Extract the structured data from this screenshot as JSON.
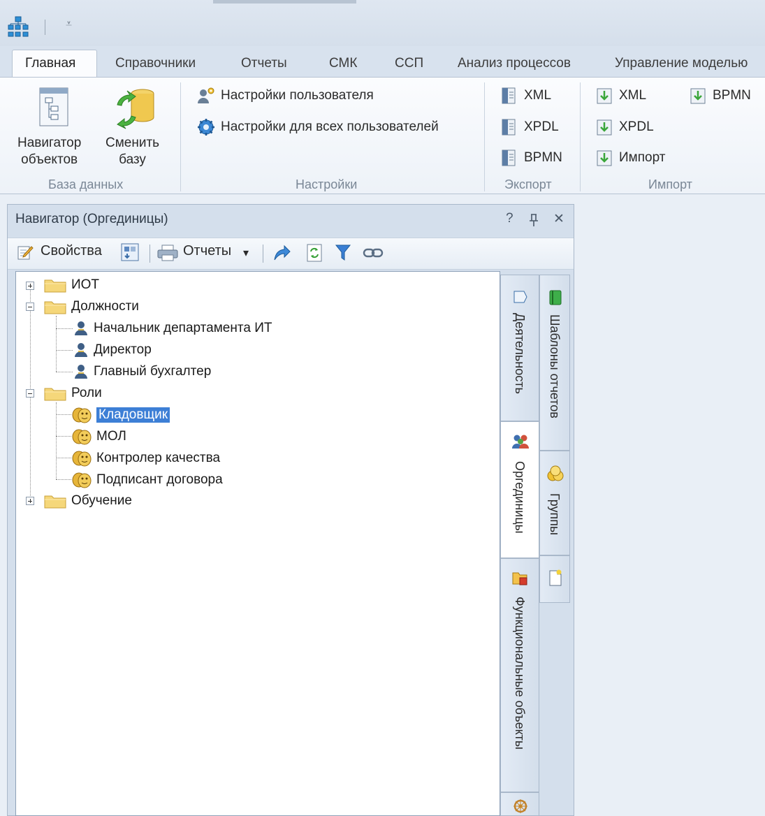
{
  "quick_access": {
    "app_icon": "org-structure-icon",
    "dropdown_glyph": "⩡"
  },
  "ribbon": {
    "tabs": [
      {
        "label": "Главная",
        "active": true
      },
      {
        "label": "Справочники"
      },
      {
        "label": "Отчеты"
      },
      {
        "label": "СМК"
      },
      {
        "label": "ССП"
      },
      {
        "label": "Анализ процессов"
      },
      {
        "label": "Управление моделью"
      }
    ],
    "groups": {
      "database": {
        "label": "База данных",
        "navigator_line1": "Навигатор",
        "navigator_line2": "объектов",
        "switch_line1": "Сменить",
        "switch_line2": "базу"
      },
      "settings": {
        "label": "Настройки",
        "user_settings": "Настройки пользователя",
        "all_users_settings": "Настройки для всех пользователей"
      },
      "export": {
        "label": "Экспорт",
        "items": [
          "XML",
          "XPDL",
          "BPMN"
        ]
      },
      "import": {
        "label": "Импорт",
        "xml": "XML",
        "xpdl": "XPDL",
        "import": "Импорт",
        "bpmn": "BPMN"
      }
    }
  },
  "navigator": {
    "title": "Навигатор (Оргединицы)",
    "controls": {
      "help": "?",
      "pin": "ᅟ",
      "close": "✕"
    },
    "toolbar": {
      "properties": "Свойства",
      "reports": "Отчеты",
      "reports_arrow": "▾"
    },
    "tree": {
      "iot": "ИОТ",
      "positions": "Должности",
      "pos_items": [
        "Начальник департамента ИТ",
        "Директор",
        "Главный бухгалтер"
      ],
      "roles": "Роли",
      "role_items": [
        "Кладовщик",
        "МОЛ",
        "Контролер качества",
        "Подписант договора"
      ],
      "training": "Обучение"
    },
    "side_tabs": {
      "activity": "Деятельность",
      "org_units": "Оргединицы",
      "functional": "Функциональные объекты",
      "report_templates": "Шаблоны отчетов",
      "groups": "Группы"
    }
  }
}
